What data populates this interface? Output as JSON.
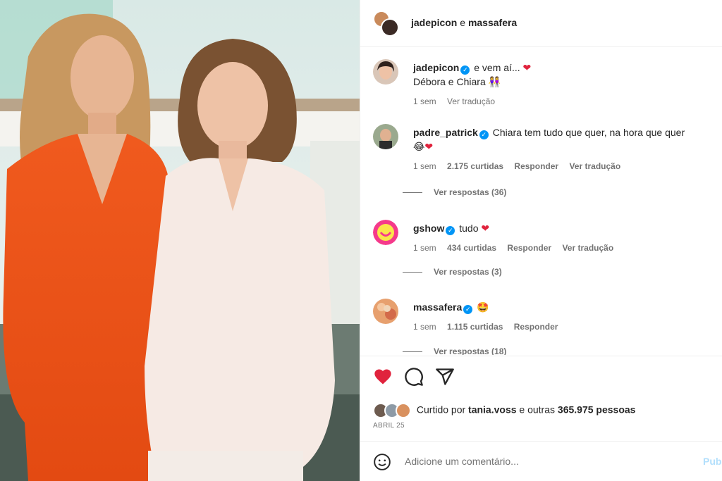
{
  "header": {
    "user1": "jadepicon",
    "joiner": "e",
    "user2": "massafera"
  },
  "comments": [
    {
      "user": "jadepicon",
      "text": "e vem aí...",
      "text_line2": "Débora e Chiara",
      "emoji_line2": "👭",
      "time": "1 sem",
      "likes": "",
      "reply": "",
      "translate": "Ver tradução",
      "replies": ""
    },
    {
      "user": "padre_patrick",
      "text": "Chiara tem tudo que quer, na hora que quer",
      "text_line2": "😂",
      "time": "1 sem",
      "likes": "2.175 curtidas",
      "reply": "Responder",
      "translate": "Ver tradução",
      "replies": "Ver respostas (36)"
    },
    {
      "user": "gshow",
      "text": "tudo",
      "time": "1 sem",
      "likes": "434 curtidas",
      "reply": "Responder",
      "translate": "Ver tradução",
      "replies": "Ver respostas (3)"
    },
    {
      "user": "massafera",
      "text": "🤩",
      "time": "1 sem",
      "likes": "1.115 curtidas",
      "reply": "Responder",
      "translate": "",
      "replies": "Ver respostas (18)"
    }
  ],
  "actions": {
    "liked_prefix": "Curtido por",
    "liked_user": "tania.voss",
    "liked_suffix": "e outras",
    "liked_count": "365.975 pessoas",
    "date": "ABRIL 25"
  },
  "add_comment": {
    "placeholder": "Adicione um comentário...",
    "publish": "Pub"
  },
  "colors": {
    "verified": "#0095f6",
    "heart": "#e0233d",
    "muted": "#737373"
  }
}
